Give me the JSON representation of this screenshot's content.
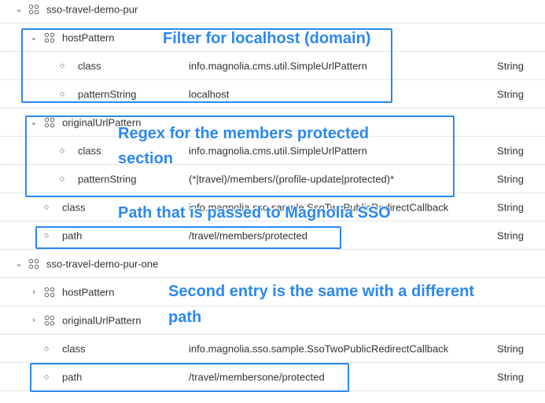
{
  "tree": {
    "root1": {
      "name": "sso-travel-demo-pur"
    },
    "hostPattern": {
      "name": "hostPattern",
      "class": {
        "name": "class",
        "value": "info.magnolia.cms.util.SimpleUrlPattern",
        "type": "String"
      },
      "patternString": {
        "name": "patternString",
        "value": "localhost",
        "type": "String"
      }
    },
    "originalUrlPattern": {
      "name": "originalUrlPattern",
      "class": {
        "name": "class",
        "value": "info.magnolia.cms.util.SimpleUrlPattern",
        "type": "String"
      },
      "patternString": {
        "name": "patternString",
        "value": "(*|travel)/members/(profile-update|protected)*",
        "type": "String"
      }
    },
    "root1_class": {
      "name": "class",
      "value": "info.magnolia.sso.sample.SsoTwoPublicRedirectCallback",
      "type": "String"
    },
    "root1_path": {
      "name": "path",
      "value": "/travel/members/protected",
      "type": "String"
    },
    "root2": {
      "name": "sso-travel-demo-pur-one"
    },
    "root2_hostPattern": {
      "name": "hostPattern"
    },
    "root2_originalUrlPattern": {
      "name": "originalUrlPattern"
    },
    "root2_class": {
      "name": "class",
      "value": "info.magnolia.sso.sample.SsoTwoPublicRedirectCallback",
      "type": "String"
    },
    "root2_path": {
      "name": "path",
      "value": "/travel/membersone/protected",
      "type": "String"
    }
  },
  "annotations": {
    "host": "Filter for localhost (domain)",
    "regex_line1": "Regex for the members protected",
    "regex_line2": "section",
    "path": "Path that is passed to Magnolia SSO",
    "second_line1": "Second entry is the same with a different",
    "second_line2": "path"
  },
  "colors": {
    "accent": "#2b88f0",
    "divider": "#e5e5e5",
    "text": "#333333"
  },
  "icons": {
    "expanded": "chevron-down-icon",
    "collapsed": "chevron-right-icon",
    "node": "node-icon",
    "property": "bullet-icon"
  }
}
